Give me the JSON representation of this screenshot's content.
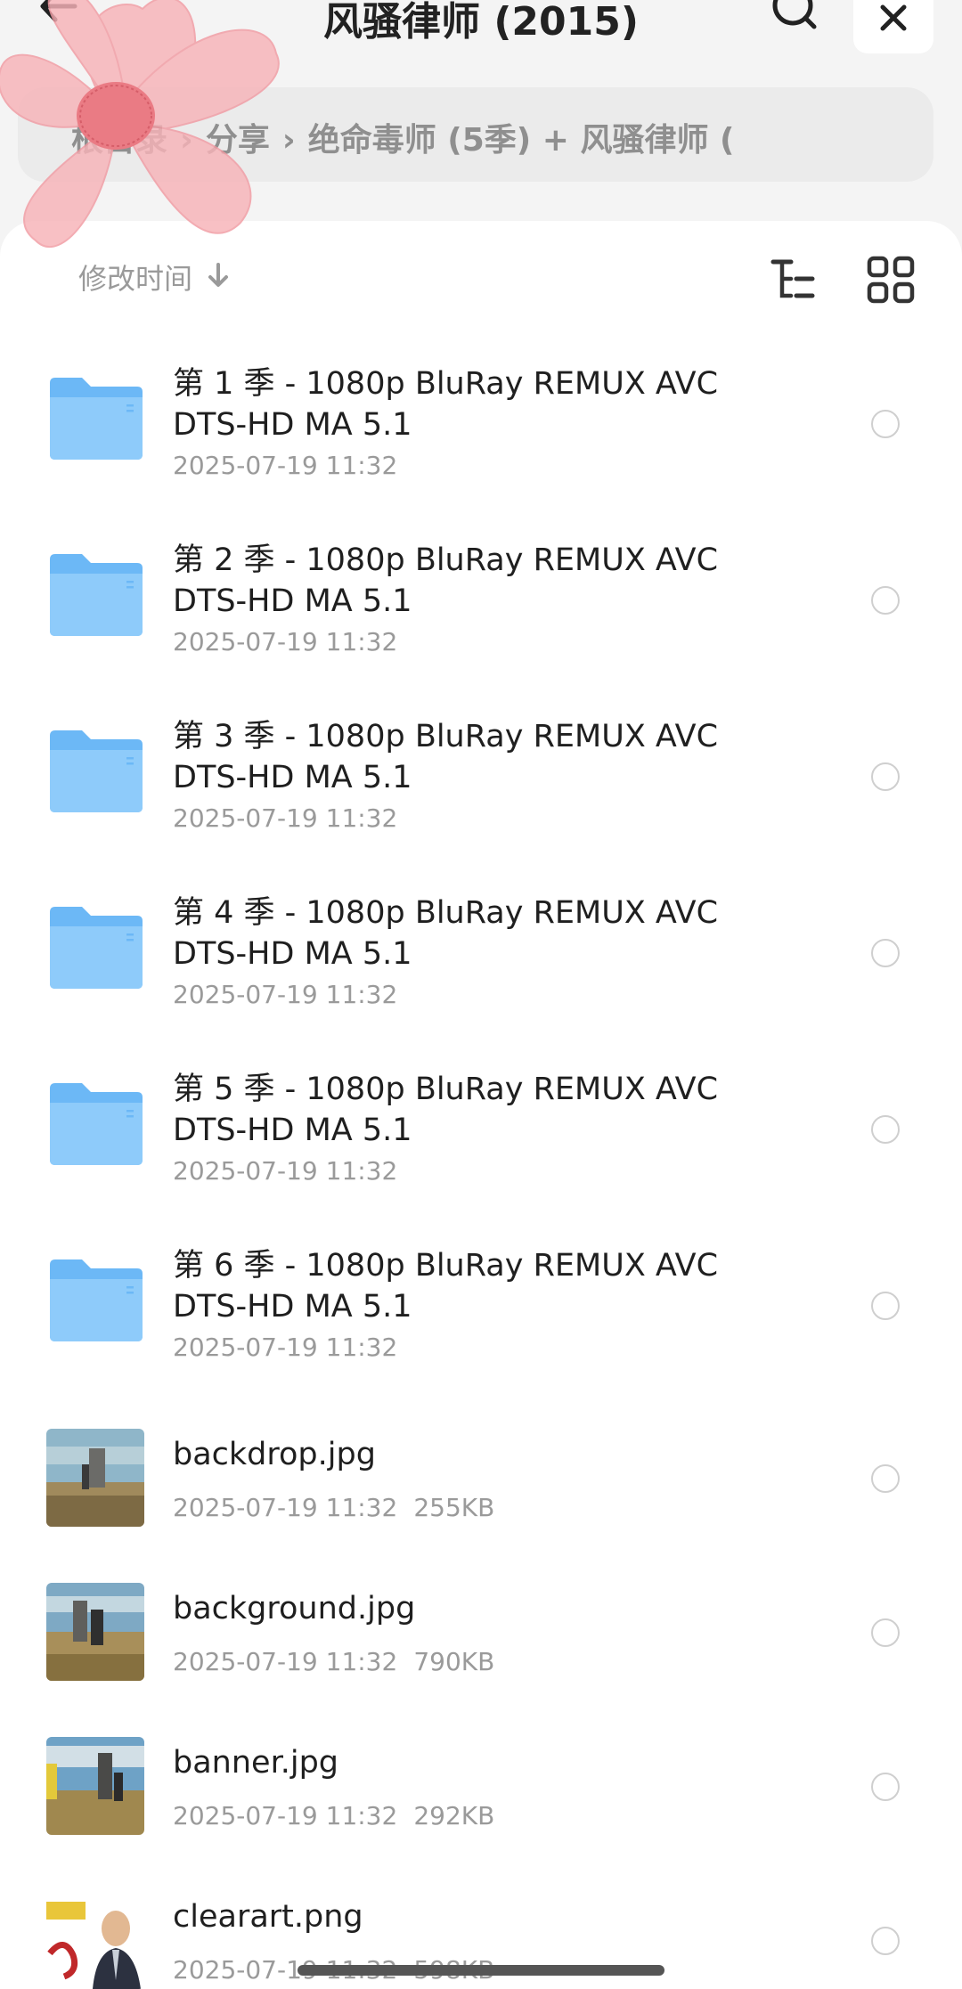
{
  "header": {
    "title": "风骚律师 (2015)"
  },
  "breadcrumb": {
    "items": [
      "根目录",
      "分享",
      "绝命毒师 (5季) + 风骚律师 ("
    ],
    "separator": "›"
  },
  "toolbar": {
    "sort_label": "修改时间"
  },
  "items": [
    {
      "type": "folder",
      "name": "第 1 季 - 1080p BluRay REMUX AVC DTS-HD MA 5.1",
      "date": "2025-07-19 11:32",
      "size": ""
    },
    {
      "type": "folder",
      "name": "第 2 季 - 1080p BluRay REMUX AVC DTS-HD MA 5.1",
      "date": "2025-07-19 11:32",
      "size": ""
    },
    {
      "type": "folder",
      "name": "第 3 季 - 1080p BluRay REMUX AVC DTS-HD MA 5.1",
      "date": "2025-07-19 11:32",
      "size": ""
    },
    {
      "type": "folder",
      "name": "第 4 季 - 1080p BluRay REMUX AVC DTS-HD MA 5.1",
      "date": "2025-07-19 11:32",
      "size": ""
    },
    {
      "type": "folder",
      "name": "第 5 季 - 1080p BluRay REMUX AVC DTS-HD MA 5.1",
      "date": "2025-07-19 11:32",
      "size": ""
    },
    {
      "type": "folder",
      "name": "第 6 季 - 1080p BluRay REMUX AVC DTS-HD MA 5.1",
      "date": "2025-07-19 11:32",
      "size": ""
    },
    {
      "type": "file",
      "name": "backdrop.jpg",
      "date": "2025-07-19 11:32",
      "size": "255KB"
    },
    {
      "type": "file",
      "name": "background.jpg",
      "date": "2025-07-19 11:32",
      "size": "790KB"
    },
    {
      "type": "file",
      "name": "banner.jpg",
      "date": "2025-07-19 11:32",
      "size": "292KB"
    },
    {
      "type": "file",
      "name": "clearart.png",
      "date": "2025-07-19 11:32",
      "size": "598KB"
    }
  ],
  "colors": {
    "folder": "#6cb8f6",
    "panel": "#ffffff",
    "background": "#f4f4f4",
    "secondary_text": "#9a9a9a"
  },
  "icons": [
    "back-arrow-icon",
    "search-icon",
    "close-icon",
    "sort-down-icon",
    "tree-view-icon",
    "grid-view-icon",
    "folder-icon"
  ]
}
